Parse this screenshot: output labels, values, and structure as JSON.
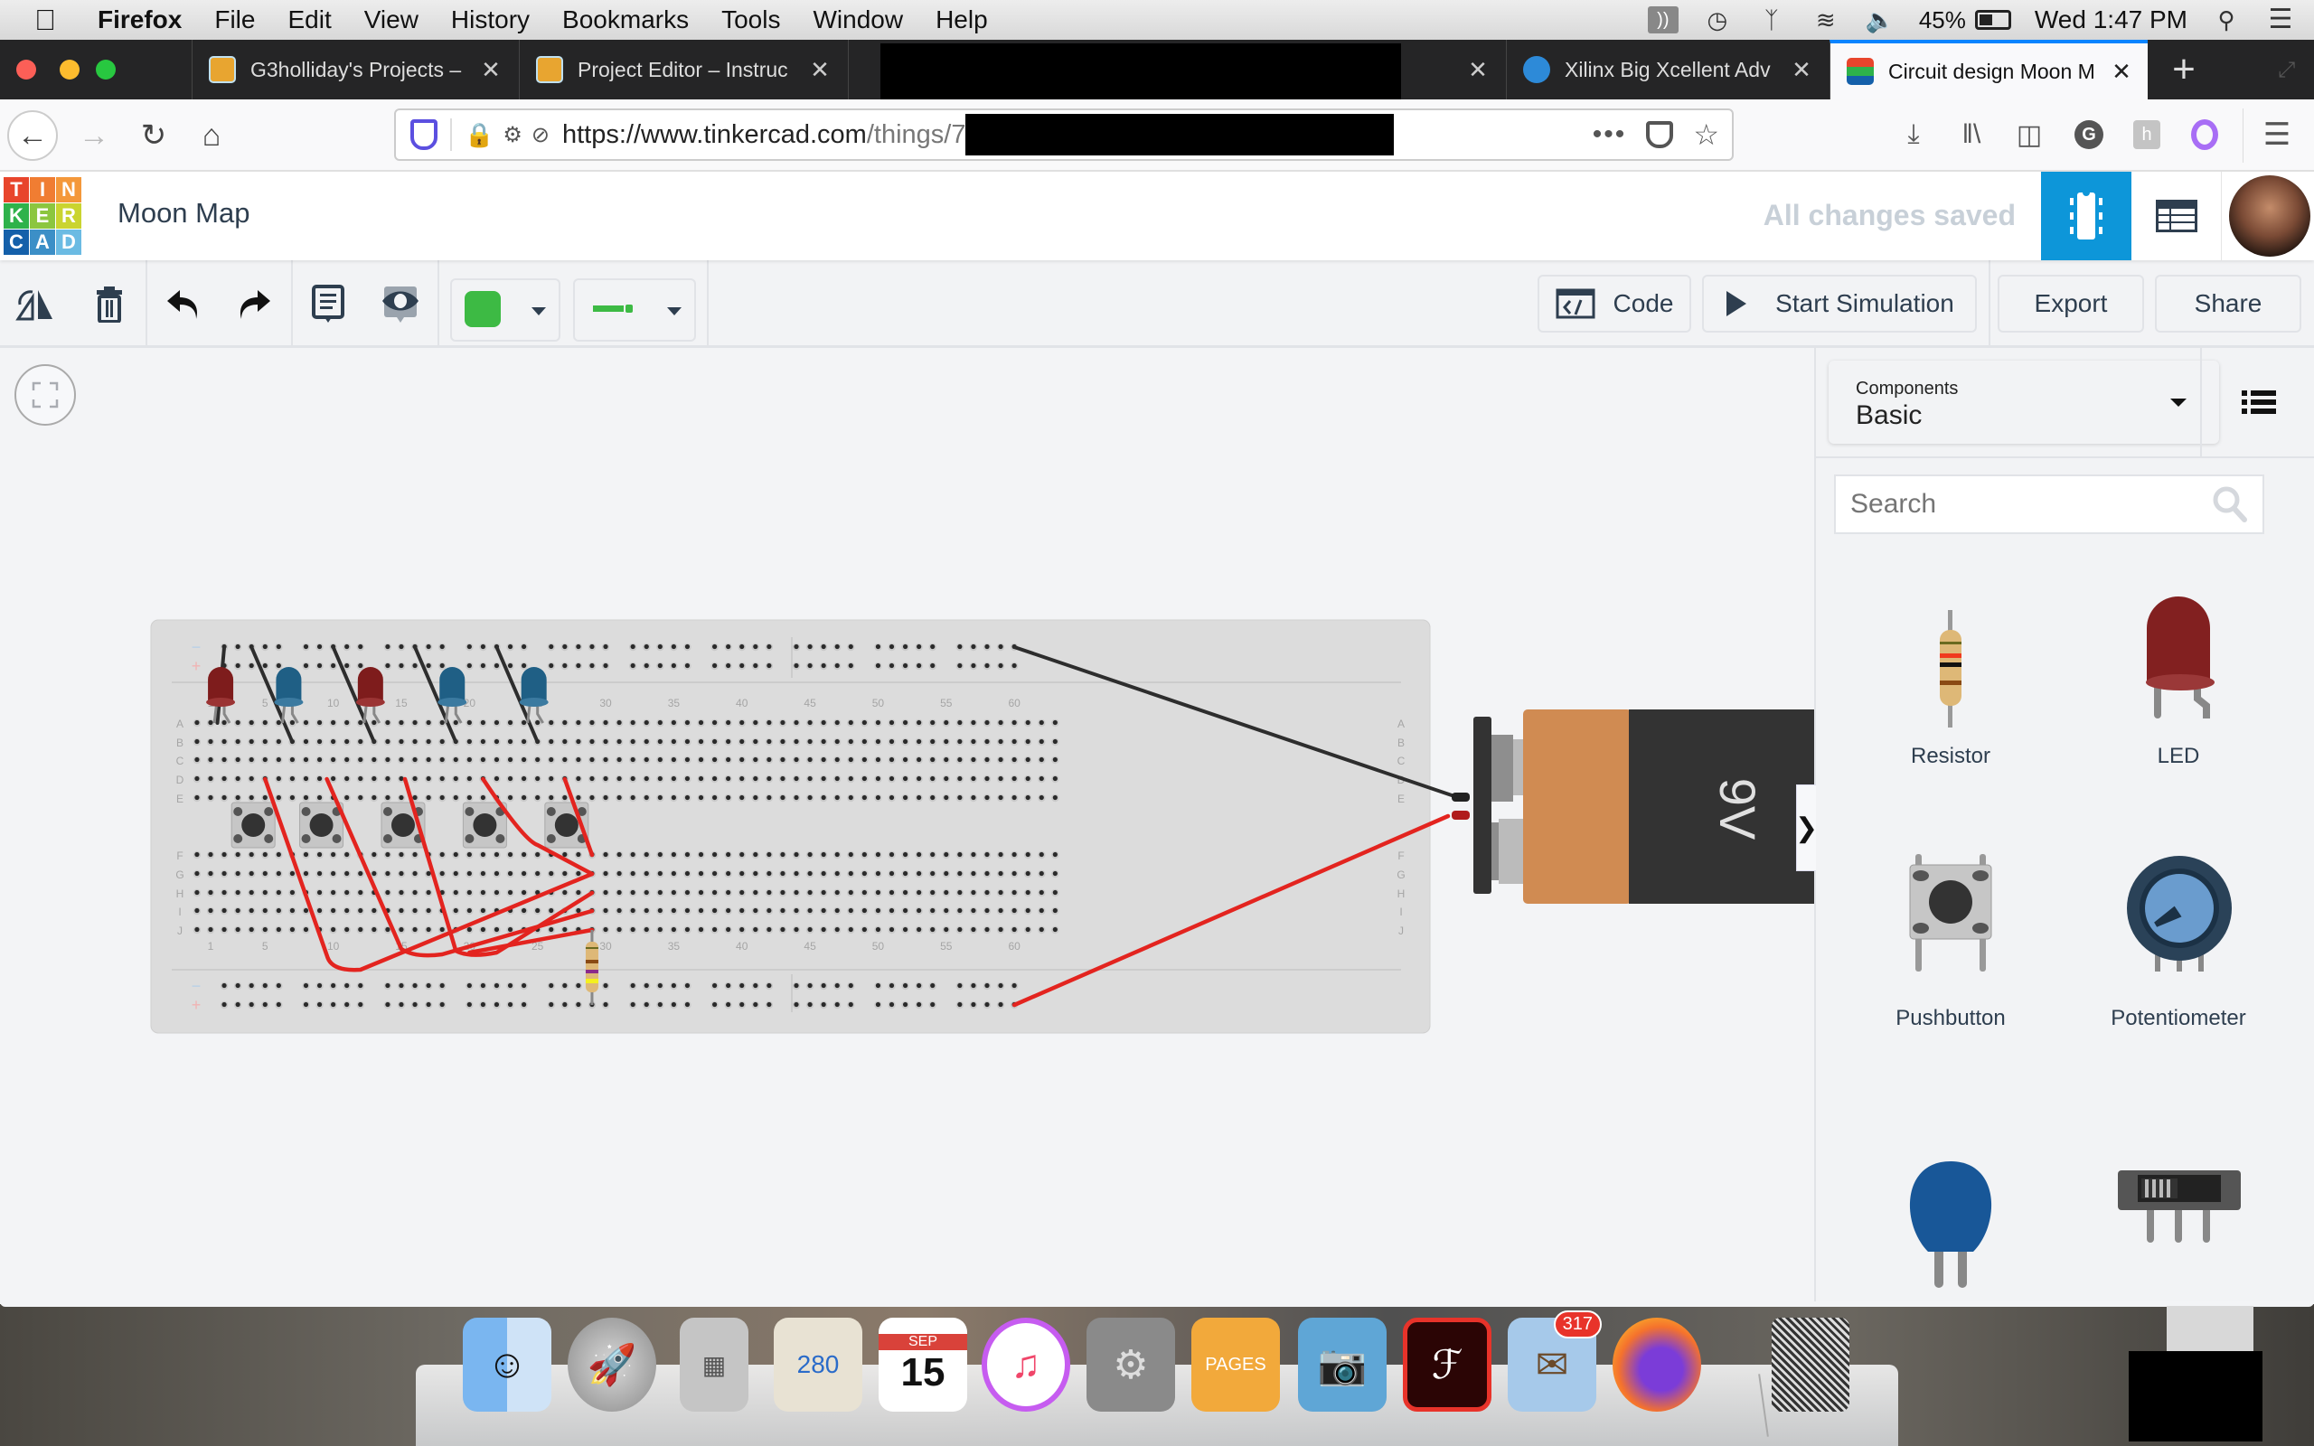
{
  "menubar": {
    "apple_icon": "apple-logo-icon",
    "items": [
      "Firefox",
      "File",
      "Edit",
      "View",
      "History",
      "Bookmarks",
      "Tools",
      "Window",
      "Help"
    ],
    "status": {
      "battery_percent": "45%",
      "clock": "Wed 1:47 PM"
    }
  },
  "browser": {
    "tabs": [
      {
        "label": "G3holliday's Projects –",
        "favicon": "instructables-robot-icon",
        "active": false
      },
      {
        "label": "Project Editor – Instruc",
        "favicon": "instructables-robot-icon",
        "active": false
      },
      {
        "label": "",
        "favicon": "",
        "active": false,
        "redacted": true
      },
      {
        "label": "Xilinx Big Xcellent Adv",
        "favicon": "hackster-icon",
        "active": false
      },
      {
        "label": "Circuit design Moon M",
        "favicon": "tinkercad-icon",
        "active": true
      }
    ],
    "new_tab_label": "+",
    "url": {
      "scheme_host": "https://www.tinkercad.com",
      "path": "/things/7"
    }
  },
  "tinkercad": {
    "logo_letters": [
      "T",
      "I",
      "N",
      "K",
      "E",
      "R",
      "C",
      "A",
      "D"
    ],
    "logo_colors": [
      "#e8452c",
      "#f07d32",
      "#f4983a",
      "#2eb24b",
      "#8cc63f",
      "#cad430",
      "#1460aa",
      "#3c8fc7",
      "#6bbbe3"
    ],
    "project_title": "Moon Map",
    "save_status": "All changes saved",
    "accent_color": "#0d96d9"
  },
  "toolbar": {
    "color_swatch": "#3dba44",
    "wire_color": "#3dba44",
    "code_label": "Code",
    "simulate_label": "Start Simulation",
    "export_label": "Export",
    "share_label": "Share"
  },
  "panel": {
    "select_label": "Components",
    "select_value": "Basic",
    "search_placeholder": "Search",
    "components": [
      {
        "name": "Resistor"
      },
      {
        "name": "LED"
      },
      {
        "name": "Pushbutton"
      },
      {
        "name": "Potentiometer"
      },
      {
        "name": ""
      },
      {
        "name": ""
      }
    ]
  },
  "circuit": {
    "breadboard": {
      "column_labels": [
        "1",
        "5",
        "10",
        "15",
        "20",
        "25",
        "30",
        "35",
        "40",
        "45",
        "50",
        "55",
        "60"
      ],
      "row_labels_top": [
        "A",
        "B",
        "C",
        "D",
        "E"
      ],
      "row_labels_bottom": [
        "F",
        "G",
        "H",
        "I",
        "J"
      ],
      "rail_labels": [
        "−",
        "+"
      ]
    },
    "leds": [
      {
        "color": "red",
        "column": 2
      },
      {
        "color": "blue",
        "column": 7
      },
      {
        "color": "red",
        "column": 13
      },
      {
        "color": "blue",
        "column": 19
      },
      {
        "color": "blue",
        "column": 25
      }
    ],
    "pushbuttons": [
      {
        "column": 4
      },
      {
        "column": 9
      },
      {
        "column": 15
      },
      {
        "column": 21
      },
      {
        "column": 27
      }
    ],
    "battery": {
      "label": "9V"
    },
    "resistor": {
      "column": 29
    }
  },
  "dock": {
    "apps": [
      {
        "name": "Finder"
      },
      {
        "name": "Launchpad"
      },
      {
        "name": "Calculator"
      },
      {
        "name": "Maps"
      },
      {
        "name": "Calendar",
        "text": "15",
        "month": "SEP"
      },
      {
        "name": "iTunes"
      },
      {
        "name": "System Preferences"
      },
      {
        "name": "Pages"
      },
      {
        "name": "Image Capture"
      },
      {
        "name": "Adobe Acrobat"
      },
      {
        "name": "Mail",
        "badge": "317"
      },
      {
        "name": "Firefox"
      },
      {
        "name": "Trash"
      }
    ]
  }
}
